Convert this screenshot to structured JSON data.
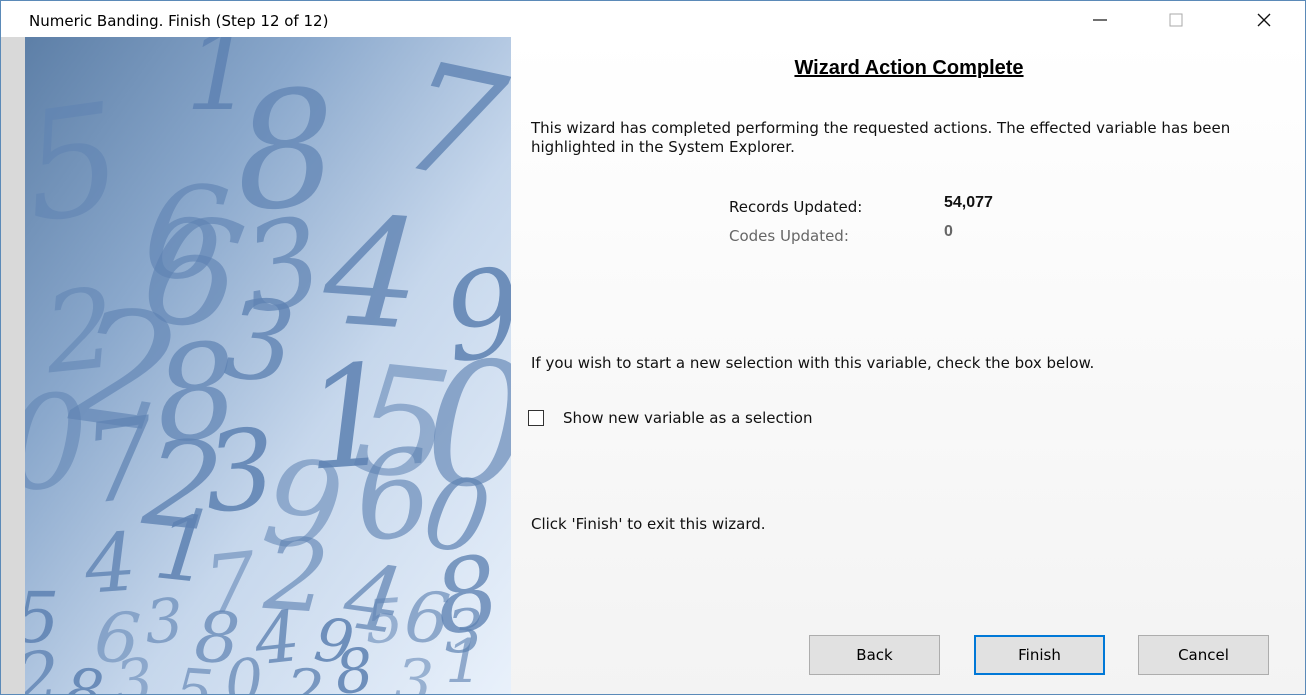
{
  "window": {
    "title": "Numeric Banding.  Finish (Step 12 of 12)",
    "controls": {
      "minimize": "—",
      "maximize": "□",
      "close": "✕"
    }
  },
  "art": {
    "digits": [
      "5",
      "6",
      "8",
      "7",
      "1",
      "2",
      "6",
      "3",
      "4",
      "9",
      "0",
      "2",
      "8",
      "3",
      "1",
      "5",
      "0",
      "7",
      "2",
      "3",
      "9",
      "6",
      "0",
      "4",
      "1",
      "7",
      "2",
      "4",
      "8",
      "5",
      "6",
      "3",
      "8",
      "4",
      "9",
      "5",
      "6",
      "3",
      "2",
      "8",
      "3",
      "5",
      "0",
      "2",
      "8",
      "3",
      "1"
    ]
  },
  "content": {
    "heading": "Wizard Action Complete",
    "description": "This wizard has completed performing the requested actions. The effected variable has been highlighted in the System Explorer.",
    "stats": {
      "records_label": "Records Updated:",
      "records_value": "54,077",
      "codes_label": "Codes Updated:",
      "codes_value": "0"
    },
    "selection_prompt": "If you wish to start a new selection with this variable, check the box below.",
    "checkbox_label": "Show new variable as a selection",
    "checkbox_checked": false,
    "finish_instruction": "Click 'Finish' to exit this wizard."
  },
  "buttons": {
    "back": "Back",
    "finish": "Finish",
    "cancel": "Cancel"
  },
  "colors": {
    "accent": "#0078d7",
    "art_digits": "#5f83b3"
  }
}
